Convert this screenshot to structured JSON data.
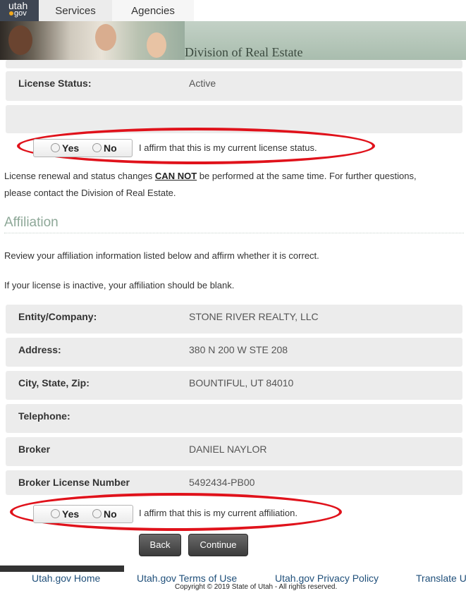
{
  "nav": {
    "logo_top": "utah",
    "logo_bottom": "gov",
    "tabs": [
      "Services",
      "Agencies"
    ]
  },
  "banner": {
    "title": "Division of Real Estate"
  },
  "license": {
    "status_label": "License Status:",
    "status_value": "Active",
    "affirm": {
      "yes": "Yes",
      "no": "No",
      "text": "I affirm that this is my current license status."
    },
    "notice_pre": "License renewal and status changes ",
    "notice_emph": "CAN NOT",
    "notice_post": " be performed at the same time. For further questions,",
    "notice_line2": "please contact the Division of Real Estate."
  },
  "affiliation": {
    "heading": "Affiliation",
    "intro": "Review your affiliation information listed below and affirm whether it is correct.",
    "note": "If your license is inactive, your affiliation should be blank.",
    "fields": [
      {
        "label": "Entity/Company:",
        "value": "STONE RIVER REALTY, LLC"
      },
      {
        "label": "Address:",
        "value": "380 N 200 W STE 208"
      },
      {
        "label": "City, State, Zip:",
        "value": "BOUNTIFUL, UT 84010"
      },
      {
        "label": "Telephone:",
        "value": ""
      },
      {
        "label": "Broker",
        "value": "DANIEL NAYLOR"
      },
      {
        "label": "Broker License Number",
        "value": "5492434-PB00"
      }
    ],
    "affirm": {
      "yes": "Yes",
      "no": "No",
      "text": "I affirm that this is my current affiliation."
    }
  },
  "buttons": {
    "back": "Back",
    "continue": "Continue"
  },
  "footer": {
    "links": [
      "Utah.gov Home",
      "Utah.gov Terms of Use",
      "Utah.gov Privacy Policy",
      "Translate U"
    ],
    "copyright": "Copyright © 2019 State of Utah - All rights reserved."
  },
  "colors": {
    "highlight_oval": "#e0121b",
    "section_heading": "#8ea898"
  }
}
